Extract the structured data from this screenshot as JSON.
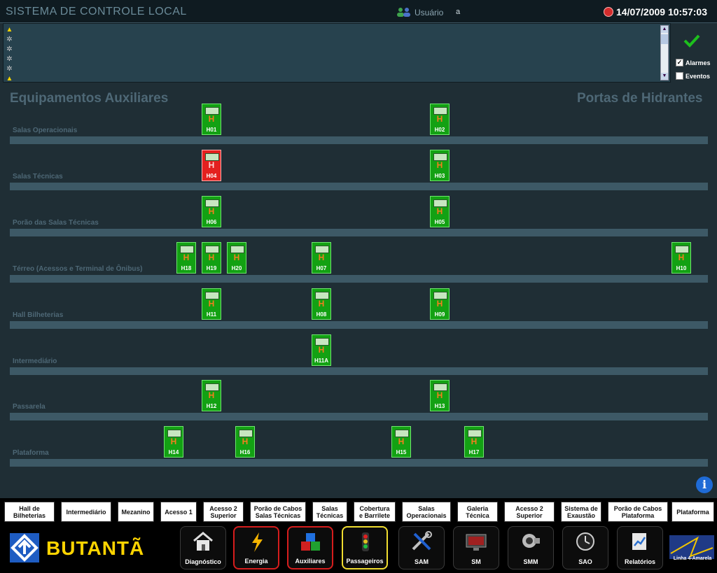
{
  "header": {
    "title": "SISTEMA DE CONTROLE LOCAL",
    "user_label": "Usuário",
    "user_value": "a",
    "datetime": "14/07/2009 10:57:03"
  },
  "alarms": {
    "icons": [
      "warning-icon",
      "gear-icon",
      "gear-icon",
      "gear-icon",
      "gear-icon",
      "warning-icon"
    ],
    "checkbox_alarmes": {
      "label": "Alarmes",
      "checked": true
    },
    "checkbox_eventos": {
      "label": "Eventos",
      "checked": false
    }
  },
  "main": {
    "heading_left": "Equipamentos Auxiliares",
    "heading_right": "Portas de Hidrantes",
    "zones": [
      {
        "label": "Salas Operacionais",
        "tiles": [
          {
            "id": "H01",
            "status": "normal"
          },
          {
            "id": "H02",
            "status": "normal"
          }
        ]
      },
      {
        "label": "Salas Técnicas",
        "tiles": [
          {
            "id": "H04",
            "status": "alarm"
          },
          {
            "id": "H03",
            "status": "normal"
          }
        ]
      },
      {
        "label": "Porão das Salas Técnicas",
        "tiles": [
          {
            "id": "H06",
            "status": "normal"
          },
          {
            "id": "H05",
            "status": "normal"
          }
        ]
      },
      {
        "label": "Térreo (Acessos e Terminal de Ônibus)",
        "tiles": [
          {
            "id": "H18",
            "status": "normal"
          },
          {
            "id": "H19",
            "status": "normal"
          },
          {
            "id": "H20",
            "status": "normal"
          },
          {
            "id": "H07",
            "status": "normal"
          },
          {
            "id": "H10",
            "status": "normal"
          }
        ]
      },
      {
        "label": "Hall Bilheterias",
        "tiles": [
          {
            "id": "H11",
            "status": "normal"
          },
          {
            "id": "H08",
            "status": "normal"
          },
          {
            "id": "H09",
            "status": "normal"
          }
        ]
      },
      {
        "label": "Intermediário",
        "tiles": [
          {
            "id": "H11A",
            "status": "normal"
          }
        ]
      },
      {
        "label": "Passarela",
        "tiles": [
          {
            "id": "H12",
            "status": "normal"
          },
          {
            "id": "H13",
            "status": "normal"
          }
        ]
      },
      {
        "label": "Plataforma",
        "tiles": [
          {
            "id": "H14",
            "status": "normal"
          },
          {
            "id": "H16",
            "status": "normal"
          },
          {
            "id": "H15",
            "status": "normal"
          },
          {
            "id": "H17",
            "status": "normal"
          }
        ]
      }
    ],
    "tile_glyph": "H"
  },
  "nav_buttons": [
    "Hall de\nBilheterias",
    "Intermediário",
    "Mezanino",
    "Acesso 1",
    "Acesso 2\nSuperior",
    "Porão de Cabos\nSalas Técnicas",
    "Salas\nTécnicas",
    "Cobertura\ne Barrilete",
    "Salas\nOperacionais",
    "Galeria\nTécnica",
    "Acesso 2\nSuperior",
    "Sistema de\nExaustão",
    "Porão de Cabos\nPlataforma",
    "Plataforma"
  ],
  "station": {
    "name": "BUTANTÃ",
    "line_label": "Linha 4-Amarela"
  },
  "systems": [
    {
      "label": "Diagnóstico",
      "icon": "house-icon",
      "highlight": "none"
    },
    {
      "label": "Energia",
      "icon": "lightning-icon",
      "highlight": "red"
    },
    {
      "label": "Auxiliares",
      "icon": "cubes-icon",
      "highlight": "red"
    },
    {
      "label": "Passageiros",
      "icon": "traffic-light-icon",
      "highlight": "yellow"
    },
    {
      "label": "SAM",
      "icon": "tools-icon",
      "highlight": "none"
    },
    {
      "label": "SM",
      "icon": "monitor-icon",
      "highlight": "none"
    },
    {
      "label": "SMM",
      "icon": "camera-icon",
      "highlight": "none"
    },
    {
      "label": "SAO",
      "icon": "clock-icon",
      "highlight": "none"
    },
    {
      "label": "Relatórios",
      "icon": "report-icon",
      "highlight": "none"
    }
  ],
  "colors": {
    "normal": "#13a113",
    "alarm": "#e4201f",
    "accent": "#ffd400"
  }
}
